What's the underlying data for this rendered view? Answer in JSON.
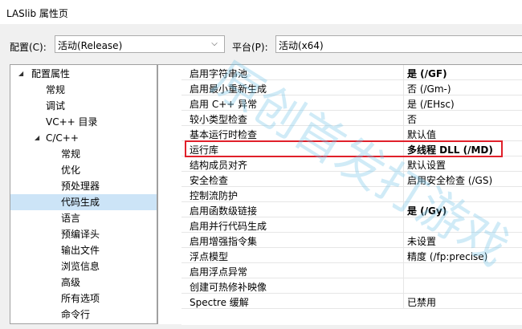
{
  "window": {
    "title": "LASlib 属性页"
  },
  "config": {
    "config_label": "配置(C):",
    "config_value": "活动(Release)",
    "platform_label": "平台(P):",
    "platform_value": "活动(x64)"
  },
  "tree": {
    "items": [
      {
        "label": "配置属性",
        "expanded": true
      },
      {
        "label": "常规"
      },
      {
        "label": "调试"
      },
      {
        "label": "VC++ 目录"
      },
      {
        "label": "C/C++",
        "expanded": true
      },
      {
        "label": "常规"
      },
      {
        "label": "优化"
      },
      {
        "label": "预处理器"
      },
      {
        "label": "代码生成",
        "selected": true
      },
      {
        "label": "语言"
      },
      {
        "label": "预编译头"
      },
      {
        "label": "输出文件"
      },
      {
        "label": "浏览信息"
      },
      {
        "label": "高级"
      },
      {
        "label": "所有选项"
      },
      {
        "label": "命令行"
      }
    ]
  },
  "properties": [
    {
      "name": "启用字符串池",
      "value": "是 (/GF)",
      "bold": true
    },
    {
      "name": "启用最小重新生成",
      "value": "否 (/Gm-)"
    },
    {
      "name": "启用 C++ 异常",
      "value": "是 (/EHsc)"
    },
    {
      "name": "较小类型检查",
      "value": "否"
    },
    {
      "name": "基本运行时检查",
      "value": "默认值"
    },
    {
      "name": "运行库",
      "value": "多线程 DLL (/MD)",
      "bold": true,
      "highlighted": true
    },
    {
      "name": "结构成员对齐",
      "value": "默认设置"
    },
    {
      "name": "安全检查",
      "value": "启用安全检查 (/GS)"
    },
    {
      "name": "控制流防护",
      "value": ""
    },
    {
      "name": "启用函数级链接",
      "value": "是 (/Gy)",
      "bold": true
    },
    {
      "name": "启用并行代码生成",
      "value": ""
    },
    {
      "name": "启用增强指令集",
      "value": "未设置"
    },
    {
      "name": "浮点模型",
      "value": "精度 (/fp:precise)"
    },
    {
      "name": "启用浮点异常",
      "value": ""
    },
    {
      "name": "创建可热修补映像",
      "value": ""
    },
    {
      "name": "Spectre 缓解",
      "value": "已禁用"
    }
  ],
  "watermark": {
    "text": "原创首发打游戏"
  },
  "colors": {
    "selection": "#cce4f7",
    "highlight_box": "#e0202a"
  }
}
